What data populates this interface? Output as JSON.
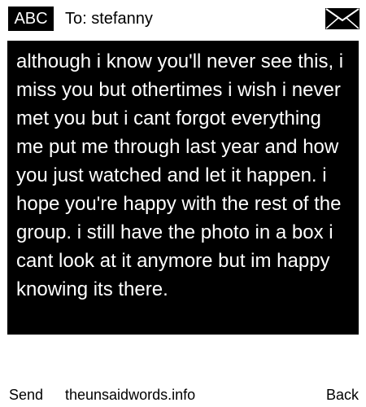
{
  "header": {
    "mode_label": "ABC",
    "to_text": "To: stefanny",
    "envelope_icon": "envelope-icon"
  },
  "message": {
    "body": "although i know you'll never see this, i miss you but othertimes i wish i never met you but i cant forgot everything me put me through last year and how you just watched and let it happen. i hope you're happy with the rest of the group. i still have the photo in a box i cant look at it anymore but im happy knowing its there."
  },
  "softkeys": {
    "left": "Send",
    "center": "theunsaidwords.info",
    "right": "Back"
  },
  "colors": {
    "background": "#ffffff",
    "panel": "#000000",
    "text_on_panel": "#ffffff",
    "text": "#000000"
  }
}
